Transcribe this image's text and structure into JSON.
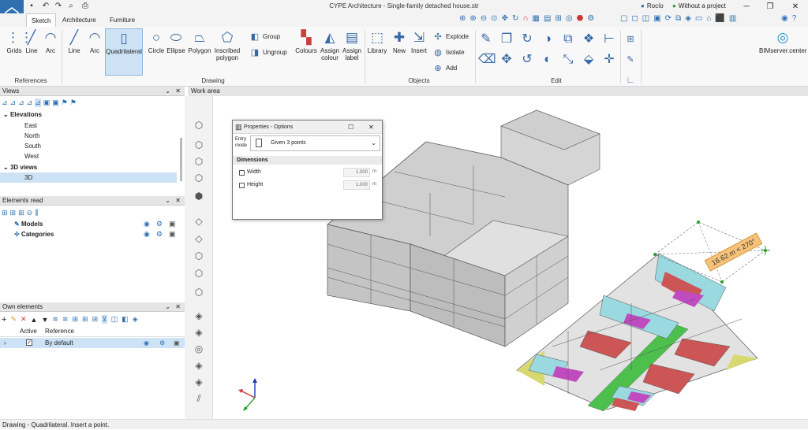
{
  "window": {
    "title": "CYPE Architecture - Single-family detached house.str",
    "user": "Rocío",
    "project": "Without a project"
  },
  "tabs": [
    "Sketch",
    "Architecture",
    "Furniture"
  ],
  "ribbon": {
    "references": {
      "label": "References",
      "buttons": [
        "Grids",
        "Line",
        "Arc"
      ]
    },
    "drawing": {
      "label": "Drawing",
      "buttons": [
        "Line",
        "Arc",
        "Quadrilateral",
        "Circle",
        "Ellipse",
        "Polygon"
      ],
      "polygon2": [
        "Inscribed",
        "polygon"
      ],
      "group": "Group",
      "ungroup": "Ungroup",
      "colours": "Colours",
      "assign_colour": [
        "Assign",
        "colour"
      ],
      "assign_label": [
        "Assign",
        "label"
      ]
    },
    "objects": {
      "label": "Objects",
      "buttons": [
        "Library",
        "New",
        "Insert"
      ],
      "explode": "Explode",
      "isolate": "Isolate",
      "add": "Add"
    },
    "edit": {
      "label": "Edit"
    },
    "bim": {
      "label": "BIMserver.center"
    }
  },
  "views": {
    "title": "Views",
    "elevations": "Elevations",
    "items": [
      "East",
      "North",
      "South",
      "West"
    ],
    "views3d": "3D views",
    "item3d": "3D"
  },
  "elements_read": {
    "title": "Elements read",
    "models": "Models",
    "categories": "Categories"
  },
  "own_elements": {
    "title": "Own elements",
    "col_active": "Active",
    "col_reference": "Reference",
    "row": "By default"
  },
  "work_area": {
    "title": "Work area",
    "dimension": "16.62 m < 270°"
  },
  "dialog": {
    "title": "Properties - Options",
    "entry_mode_label": [
      "Entry",
      "mode"
    ],
    "entry_mode": "Given 3 points",
    "section": "Dimensions",
    "width_label": "Width",
    "width_value": "1.000",
    "height_label": "Height",
    "height_value": "1.000",
    "unit": "m"
  },
  "status": "Drawing - Quadrilateral. Insert a point.",
  "colors": {
    "accent": "#2f6fb0",
    "selection": "#cde3f5",
    "dim_label": "#f6c27a"
  }
}
